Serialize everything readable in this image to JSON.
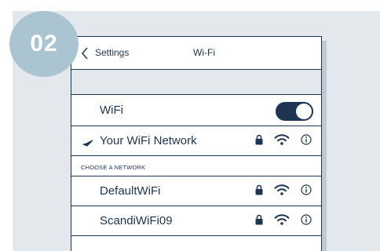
{
  "step": {
    "number": "02"
  },
  "nav": {
    "back_label": "Settings",
    "title": "Wi-Fi"
  },
  "wifi_toggle": {
    "label": "WiFi",
    "state": "on"
  },
  "connected_network": {
    "name": "Your WiFi Network",
    "secured": true
  },
  "section": {
    "label": "CHOOSE A NETWORK"
  },
  "networks": [
    {
      "name": "DefaultWiFi",
      "secured": true
    },
    {
      "name": "ScandiWiFi09",
      "secured": true
    }
  ],
  "colors": {
    "ink": "#1d3452",
    "badge": "#aac5d1",
    "panel": "#e3e8ec"
  }
}
